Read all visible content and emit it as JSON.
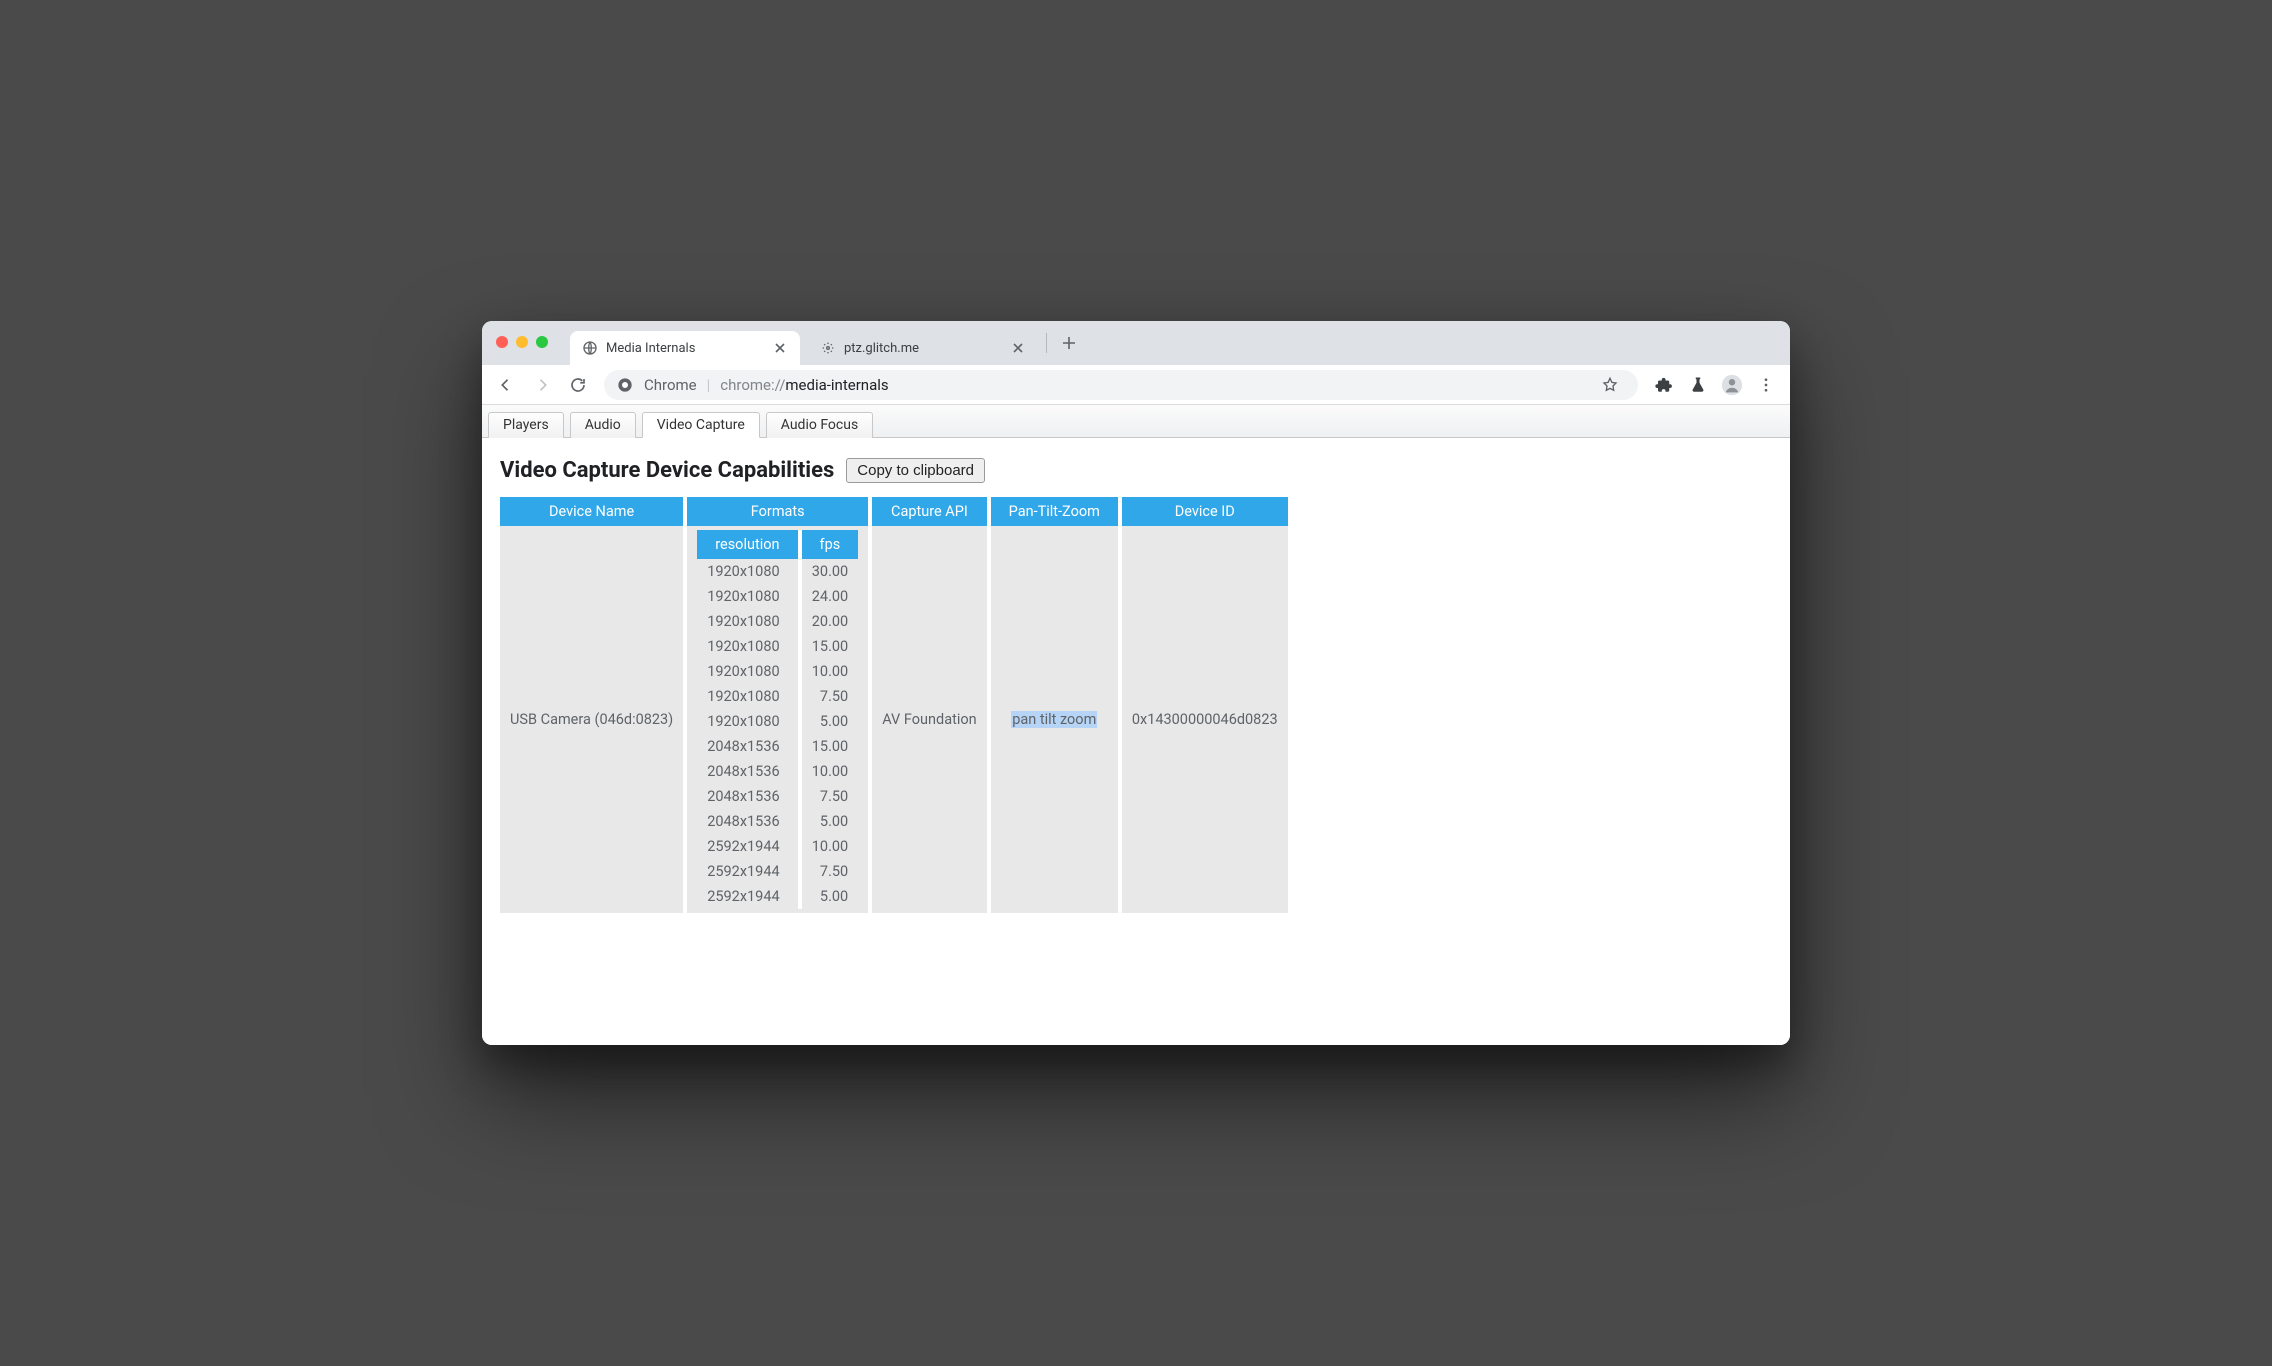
{
  "browser": {
    "tabs": [
      {
        "title": "Media Internals",
        "active": true
      },
      {
        "title": "ptz.glitch.me",
        "active": false
      }
    ],
    "address": {
      "origin_label": "Chrome",
      "url_scheme": "chrome://",
      "url_path": "media-internals"
    }
  },
  "page": {
    "subtabs": {
      "players": "Players",
      "audio": "Audio",
      "video_capture": "Video Capture",
      "audio_focus": "Audio Focus"
    },
    "heading": "Video Capture Device Capabilities",
    "copy_button": "Copy to clipboard",
    "columns": {
      "device_name": "Device Name",
      "formats": "Formats",
      "capture_api": "Capture API",
      "ptz": "Pan-Tilt-Zoom",
      "device_id": "Device ID"
    },
    "format_headers": {
      "resolution": "resolution",
      "fps": "fps"
    },
    "device": {
      "name": "USB Camera (046d:0823)",
      "capture_api": "AV Foundation",
      "ptz": "pan tilt zoom",
      "id": "0x14300000046d0823",
      "formats": [
        {
          "resolution": "1920x1080",
          "fps": "30.00"
        },
        {
          "resolution": "1920x1080",
          "fps": "24.00"
        },
        {
          "resolution": "1920x1080",
          "fps": "20.00"
        },
        {
          "resolution": "1920x1080",
          "fps": "15.00"
        },
        {
          "resolution": "1920x1080",
          "fps": "10.00"
        },
        {
          "resolution": "1920x1080",
          "fps": "7.50"
        },
        {
          "resolution": "1920x1080",
          "fps": "5.00"
        },
        {
          "resolution": "2048x1536",
          "fps": "15.00"
        },
        {
          "resolution": "2048x1536",
          "fps": "10.00"
        },
        {
          "resolution": "2048x1536",
          "fps": "7.50"
        },
        {
          "resolution": "2048x1536",
          "fps": "5.00"
        },
        {
          "resolution": "2592x1944",
          "fps": "10.00"
        },
        {
          "resolution": "2592x1944",
          "fps": "7.50"
        },
        {
          "resolution": "2592x1944",
          "fps": "5.00"
        }
      ]
    }
  }
}
